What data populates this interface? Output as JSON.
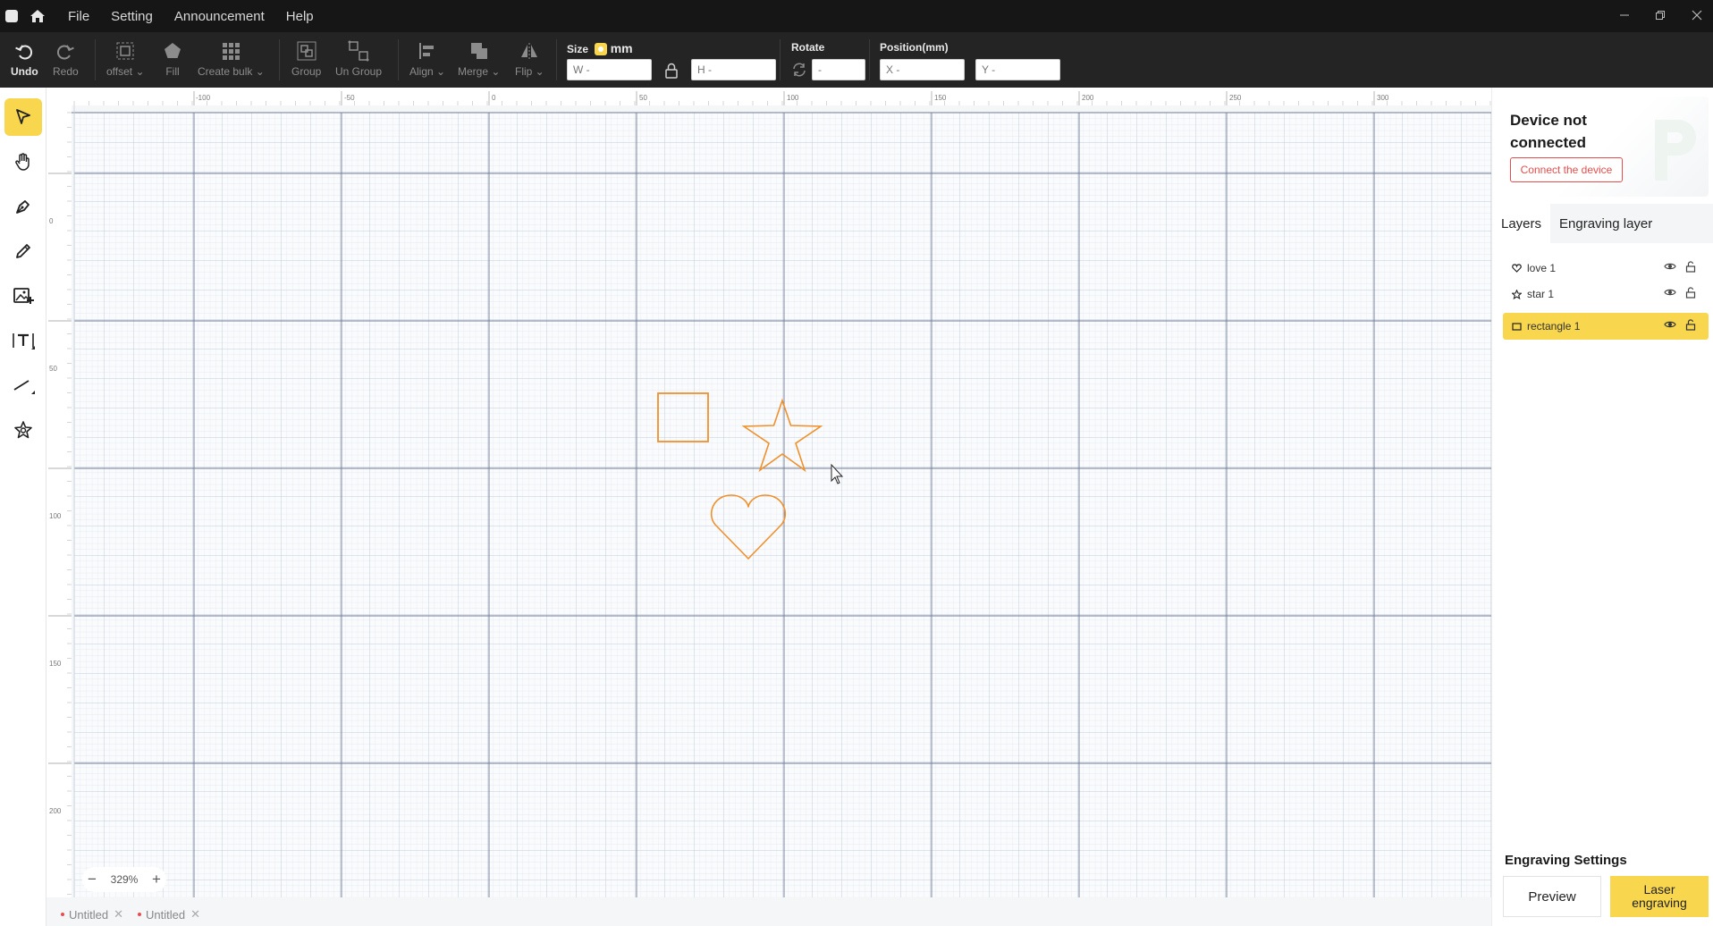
{
  "titlebar": {
    "menus": [
      "File",
      "Setting",
      "Announcement",
      "Help"
    ]
  },
  "toolbar": {
    "undo": "Undo",
    "redo": "Redo",
    "offset": "offset",
    "fill": "Fill",
    "create_bulk": "Create bulk",
    "group": "Group",
    "ungroup": "Un Group",
    "align": "Align",
    "merge": "Merge",
    "flip": "Flip",
    "size_label": "Size",
    "size_unit": "mm",
    "w_placeholder": "W -",
    "h_placeholder": "H -",
    "rotate_label": "Rotate",
    "rotate_value": "-",
    "position_label": "Position(mm)",
    "x_placeholder": "X -",
    "y_placeholder": "Y -"
  },
  "canvas": {
    "ruler_top": [
      "-100",
      "-50",
      "0",
      "50",
      "100",
      "150",
      "200",
      "250",
      "300"
    ],
    "ruler_left": [
      "0",
      "50",
      "100",
      "150",
      "200"
    ],
    "zoom": "329%",
    "zoom_minus": "−",
    "zoom_plus": "+"
  },
  "doc_tabs": [
    "Untitled",
    "Untitled"
  ],
  "right_panel": {
    "device_title": "Device not connected",
    "connect_button": "Connect the device",
    "tabs": [
      "Layers",
      "Engraving layer"
    ],
    "layers": [
      {
        "name": "love 1",
        "icon": "heart-icon",
        "selected": false
      },
      {
        "name": "star 1",
        "icon": "star-icon",
        "selected": false
      },
      {
        "name": "rectangle 1",
        "icon": "rectangle-icon",
        "selected": true
      }
    ],
    "engraving_settings_title": "Engraving Settings",
    "preview_button": "Preview",
    "laser_button": "Laser engraving"
  },
  "colors": {
    "accent": "#f8d64e",
    "shape_stroke": "#f0902a",
    "danger": "#e84d4d"
  }
}
